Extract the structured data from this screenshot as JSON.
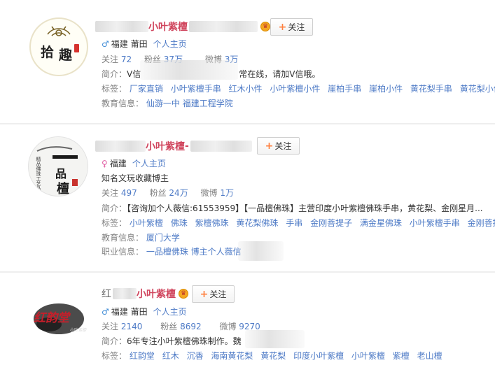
{
  "users": [
    {
      "nickname": "小叶紫檀",
      "follow_label": "关注",
      "gender": "♂",
      "location": "福建 莆田",
      "homepage_label": "个人主页",
      "stats": {
        "following_label": "关注",
        "following": "72",
        "fans_label": "粉丝",
        "fans": "37万",
        "weibo_label": "微博",
        "weibo": "3万"
      },
      "bio_label": "简介：",
      "bio_start": "V信",
      "bio_end": "常在线，请加V信哦。",
      "tags_label": "标签：",
      "tags": [
        "厂家直销",
        "小叶紫檀手串",
        "红木小件",
        "小叶紫檀小件",
        "崖柏手串",
        "崖柏小件",
        "黄花梨手串",
        "黄花梨小件"
      ],
      "edu_label": "教育信息：",
      "edu": [
        "仙游一中",
        "福建工程学院"
      ],
      "avatar_text": [
        "拾",
        "趣"
      ]
    },
    {
      "nickname": "小叶紫檀",
      "follow_label": "关注",
      "gender": "♀",
      "location": "福建",
      "homepage_label": "个人主页",
      "verified": "知名文玩收藏博主",
      "stats": {
        "following_label": "关注",
        "following": "497",
        "fans_label": "粉丝",
        "fans": "24万",
        "weibo_label": "微博",
        "weibo": "1万"
      },
      "bio_label": "简介：",
      "bio": "【咨询加个人薇信:61553959】【一品檀佛珠】主营印度小叶紫檀佛珠手串，黄花梨、金刚星月...",
      "tags_label": "标签：",
      "tags": [
        "小叶紫檀",
        "佛珠",
        "紫檀佛珠",
        "黄花梨佛珠",
        "手串",
        "金刚菩提子",
        "满金星佛珠",
        "小叶紫檀手串",
        "金刚菩提 ..."
      ],
      "edu_label": "教育信息：",
      "edu": [
        "厦门大学"
      ],
      "job_label": "职业信息：",
      "job": "一品檀佛珠 博主个人薇信",
      "avatar_text": [
        "一",
        "品",
        "檀"
      ],
      "avatar_side": "精品佛珠工艺品"
    },
    {
      "nickname": "小叶紫檀",
      "name_prefix": "红",
      "follow_label": "关注",
      "gender": "♂",
      "location": "福建 莆田",
      "homepage_label": "个人主页",
      "stats": {
        "following_label": "关注",
        "following": "2140",
        "fans_label": "粉丝",
        "fans": "8692",
        "weibo_label": "微博",
        "weibo": "9270"
      },
      "bio_label": "简介：",
      "bio": "6年专注小叶紫檀佛珠制作。魏",
      "tags_label": "标签：",
      "tags": [
        "红韵堂",
        "红木",
        "沉香",
        "海南黄花梨",
        "黄花梨",
        "印度小叶紫檀",
        "小叶紫檀",
        "紫檀",
        "老山檀"
      ],
      "avatar_text": "红韵堂"
    }
  ],
  "colors": {
    "link": "#4d7ac6",
    "nickname": "#d0455d",
    "follow_plus": "#ff8140",
    "male": "#3e8bd6",
    "female": "#e05da3"
  }
}
